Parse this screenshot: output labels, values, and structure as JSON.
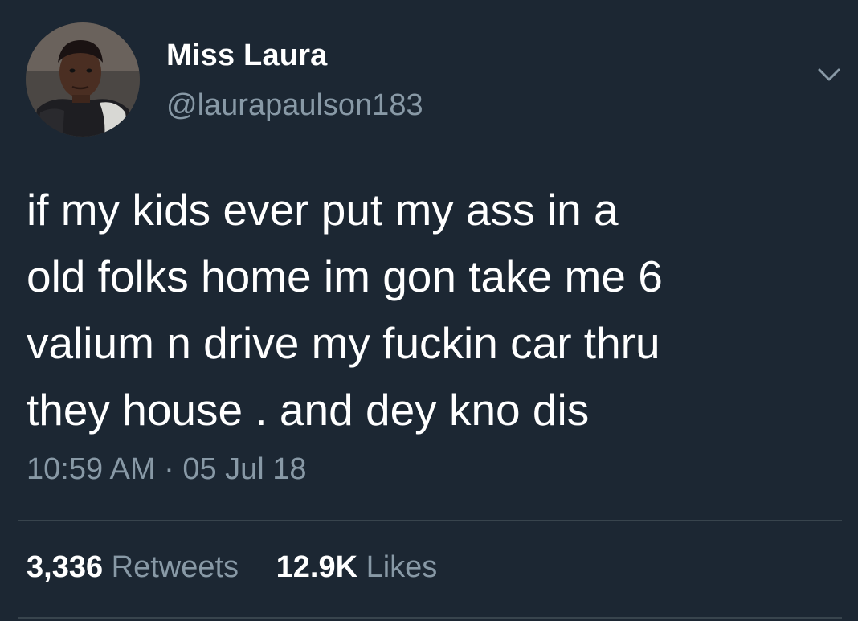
{
  "user": {
    "display_name": "Miss Laura",
    "handle": "@laurapaulson183",
    "avatar_icon": "profile-photo"
  },
  "tweet": {
    "text_lines": [
      "if my kids ever put my ass in a",
      "old folks home im gon take me 6",
      "valium n drive my fuckin car thru",
      "they house . and dey kno dis"
    ],
    "timestamp": "10:59 AM · 05 Jul 18"
  },
  "stats": {
    "retweets_count": "3,336",
    "retweets_label": "Retweets",
    "likes_count": "12.9K",
    "likes_label": "Likes"
  },
  "menu_icon": "chevron-down-icon",
  "colors": {
    "background": "#1c2733",
    "primary_text": "#ffffff",
    "secondary_text": "#8899a6",
    "divider": "#38444d"
  }
}
